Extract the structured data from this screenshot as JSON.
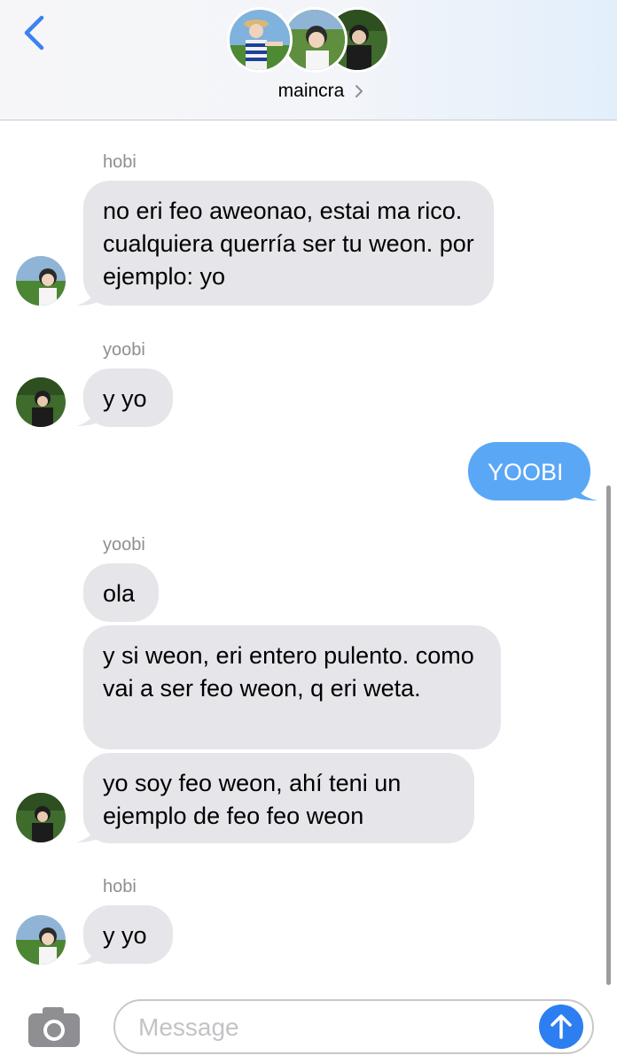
{
  "header": {
    "group_name": "maincra"
  },
  "messages": [
    {
      "sender": "hobi",
      "text": "no eri feo aweonao, estai ma rico. cualquiera querría ser tu weon. por ejemplo: yo"
    },
    {
      "sender": "yoobi",
      "text": "y yo"
    },
    {
      "text": "YOOBI"
    },
    {
      "sender": "yoobi",
      "text": "ola"
    },
    {
      "text": "y si weon, eri entero pulento. como vai a ser feo weon, q eri weta."
    },
    {
      "text": "yo soy feo weon, ahí teni un ejemplo de feo feo weon"
    },
    {
      "sender": "hobi",
      "text": "y yo"
    }
  ],
  "composer": {
    "placeholder": "Message"
  },
  "colors": {
    "incoming_bubble": "#e5e5ea",
    "outgoing_bubble": "#5aa7f6",
    "accent": "#2d7ef0"
  }
}
